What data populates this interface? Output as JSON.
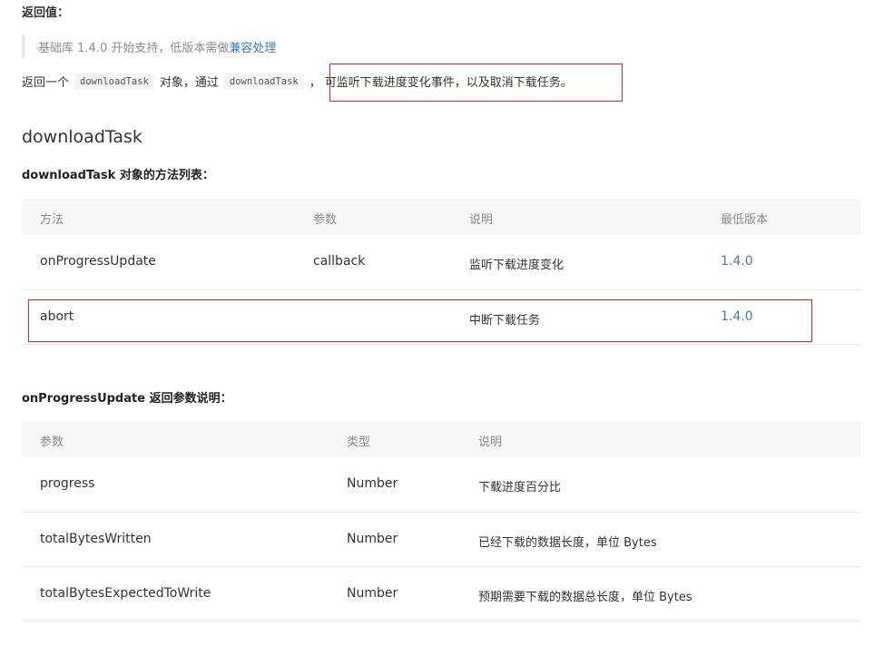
{
  "return_label": "返回值：",
  "note": {
    "text": "基础库 1.4.0 开始支持，低版本需做",
    "link": "兼容处理"
  },
  "intro": {
    "p1": "返回一个",
    "code1": "downloadTask",
    "p2": "对象，通过",
    "code2": "downloadTask",
    "p3": "，",
    "p4": "可监听下载进度变化事件，以及取消下载任务。"
  },
  "section_title": "downloadTask",
  "methods": {
    "heading_bold": "downloadTask",
    "heading_rest": " 对象的方法列表：",
    "headers": [
      "方法",
      "参数",
      "说明",
      "最低版本"
    ],
    "rows": [
      {
        "method": "onProgressUpdate",
        "param": "callback",
        "desc": "监听下载进度变化",
        "version": "1.4.0"
      },
      {
        "method": "abort",
        "param": "",
        "desc": "中断下载任务",
        "version": "1.4.0"
      }
    ]
  },
  "progress": {
    "heading_bold": "onProgressUpdate",
    "heading_rest": " 返回参数说明：",
    "headers": [
      "参数",
      "类型",
      "说明"
    ],
    "rows": [
      {
        "name": "progress",
        "type": "Number",
        "desc": "下载进度百分比"
      },
      {
        "name": "totalBytesWritten",
        "type": "Number",
        "desc": "已经下载的数据长度，单位 Bytes"
      },
      {
        "name": "totalBytesExpectedToWrite",
        "type": "Number",
        "desc": "预期需要下载的数据总长度，单位 Bytes"
      }
    ]
  },
  "colors": {
    "accent_link": "#3d7bbd",
    "highlight_box": "#e0202a"
  }
}
